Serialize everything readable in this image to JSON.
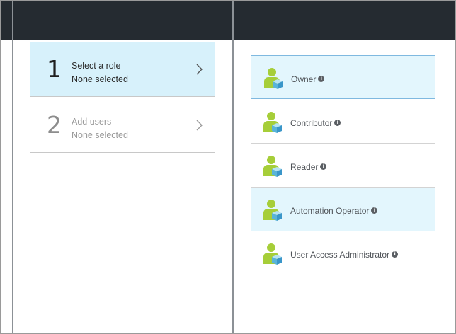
{
  "steps": [
    {
      "number": "1",
      "title": "Select a role",
      "status": "None selected"
    },
    {
      "number": "2",
      "title": "Add users",
      "status": "None selected"
    }
  ],
  "roles": [
    {
      "name": "Owner",
      "info": "i"
    },
    {
      "name": "Contributor",
      "info": "i"
    },
    {
      "name": "Reader",
      "info": "i"
    },
    {
      "name": "Automation Operator",
      "info": "i"
    },
    {
      "name": "User Access Administrator",
      "info": "i"
    }
  ],
  "colors": {
    "header_bar": "#252b31",
    "selected_step_bg": "#d7f1fb",
    "highlight_role_bg": "#e3f6fd",
    "user_icon_green": "#a6ce39",
    "cube_blue": "#59b4d9"
  },
  "icons": {
    "step_chevron": "chevron-right-icon",
    "role_icon": "user-role-icon",
    "info": "info-icon"
  }
}
